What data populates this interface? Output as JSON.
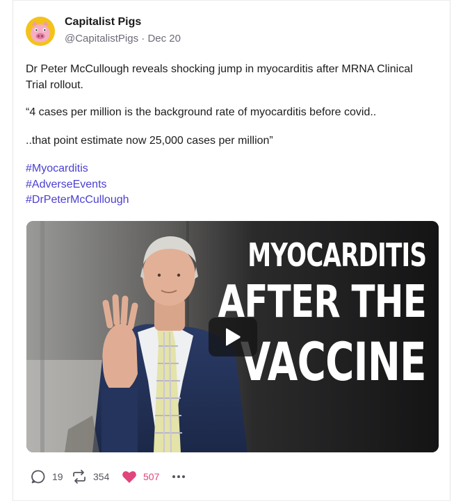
{
  "author": {
    "name": "Capitalist Pigs",
    "handle": "@CapitalistPigs",
    "separator": "·",
    "date": "Dec 20",
    "avatar_icon": "pig-avatar-icon"
  },
  "post": {
    "paragraphs": [
      "Dr Peter McCullough reveals shocking jump in myocarditis after MRNA Clinical Trial rollout.",
      "“4 cases per million is the background rate of myocarditis before covid..",
      "..that point estimate now 25,000 cases per million”"
    ],
    "hashtags": [
      "#Myocarditis",
      "#AdverseEvents",
      "#DrPeterMcCullough"
    ]
  },
  "media": {
    "headline_lines": [
      "MYOCARDITIS",
      "AFTER THE",
      "VACCINE"
    ],
    "play_icon": "play-icon"
  },
  "actions": {
    "replies": "19",
    "reposts": "354",
    "likes": "507",
    "reply_icon": "reply-icon",
    "repost_icon": "repost-icon",
    "like_icon": "heart-icon",
    "more_icon": "more-icon"
  },
  "colors": {
    "hashtag": "#4b3fd1",
    "like": "#e0457b",
    "avatar_bg": "#f3c21b",
    "meta_text": "#6b6b78"
  }
}
